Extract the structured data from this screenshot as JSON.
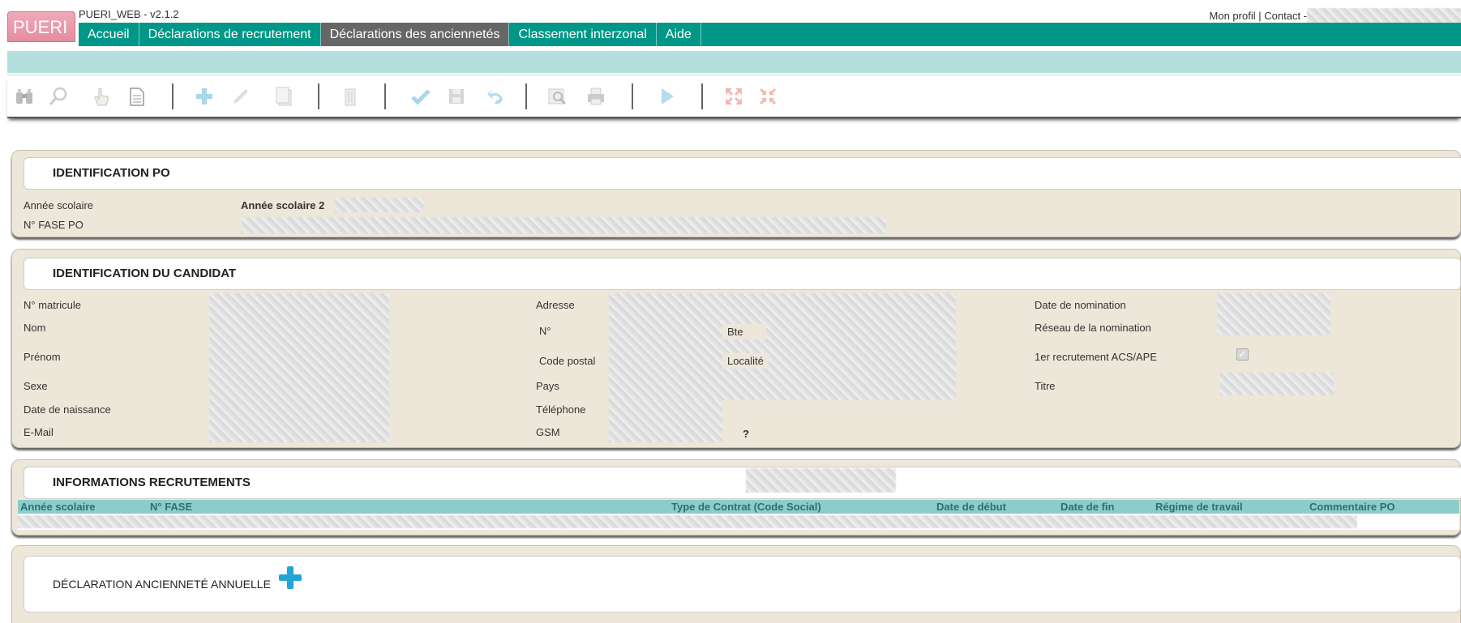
{
  "app": {
    "logo": "PUERI",
    "version": "PUERI_WEB - v2.1.2"
  },
  "header": {
    "profile_label": "Mon profil",
    "separator": "|",
    "contact_label": "Contact -"
  },
  "nav": {
    "items": [
      {
        "label": "Accueil"
      },
      {
        "label": "Déclarations de recrutement"
      },
      {
        "label": "Déclarations des anciennetés"
      },
      {
        "label": "Classement interzonal"
      },
      {
        "label": "Aide"
      }
    ],
    "active": "Déclarations des anciennetés"
  },
  "toolbar": {
    "icons": [
      "binoculars-icon",
      "zoom-icon",
      "hand-icon",
      "document-icon",
      "plus-icon",
      "pencil-icon",
      "copy-icon",
      "delete-icon",
      "check-icon",
      "save-icon",
      "undo-icon",
      "print-preview-icon",
      "print-icon",
      "play-icon",
      "expand-icon",
      "collapse-icon"
    ]
  },
  "identification_po": {
    "title": "IDENTIFICATION PO",
    "annee_label": "Année scolaire",
    "annee_value": "Année scolaire 2",
    "fase_label": "N° FASE PO"
  },
  "candidat": {
    "title": "IDENTIFICATION DU CANDIDAT",
    "left_labels": [
      "N° matricule",
      "Nom",
      "Prénom",
      "Sexe",
      "Date de naissance",
      "E-Mail"
    ],
    "mid_labels": [
      "Adresse",
      "N°",
      "Code postal",
      "Pays",
      "Téléphone",
      "GSM"
    ],
    "bte_label": "Bte",
    "localite_label": "Localité",
    "gsm_mark": "?",
    "right_labels": [
      "Date de nomination",
      "Réseau de la nomination",
      "1er recrutement ACS/APE",
      "Titre"
    ],
    "premier_recrutement_checked": true
  },
  "recrutements": {
    "title": "INFORMATIONS RECRUTEMENTS",
    "columns": [
      "Année scolaire",
      "N° FASE",
      "Type de Contrat (Code Social)",
      "Date de début",
      "Date de fin",
      "Régime de travail",
      "Commentaire PO"
    ]
  },
  "anciennete": {
    "title": "DÉCLARATION ANCIENNETÉ ANNUELLE"
  },
  "colors": {
    "nav_bg": "#009688",
    "nav_active": "#666666",
    "subbar": "#b3e0dc",
    "panel_bg": "#ede7da",
    "logo": "#e48c9f",
    "table_header": "#8ccdc9"
  }
}
